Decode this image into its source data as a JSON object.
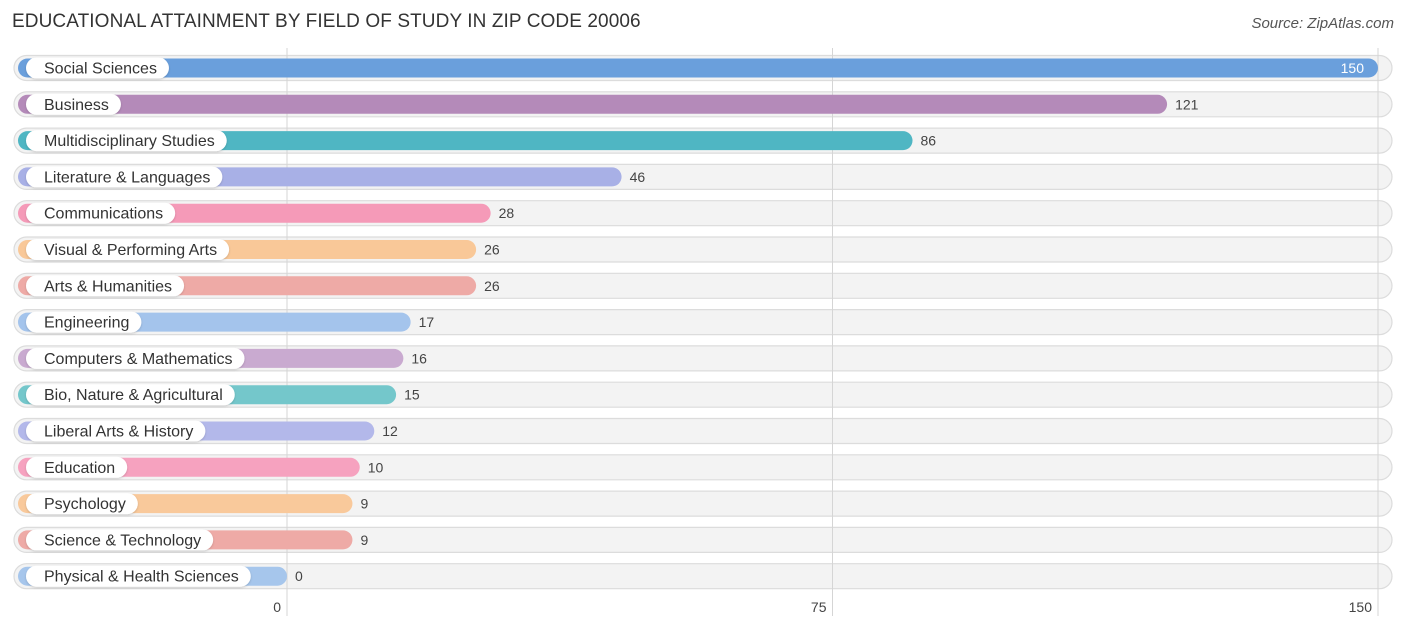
{
  "header": {
    "title": "EDUCATIONAL ATTAINMENT BY FIELD OF STUDY IN ZIP CODE 20006",
    "source": "Source: ZipAtlas.com"
  },
  "chart_data": {
    "type": "bar",
    "orientation": "horizontal",
    "title": "EDUCATIONAL ATTAINMENT BY FIELD OF STUDY IN ZIP CODE 20006",
    "xlabel": "",
    "ylabel": "",
    "xlim": [
      0,
      150
    ],
    "xticks": [
      0,
      75,
      150
    ],
    "xtick_labels": [
      "0",
      "75",
      "150"
    ],
    "grid": true,
    "categories": [
      "Social Sciences",
      "Business",
      "Multidisciplinary Studies",
      "Literature & Languages",
      "Communications",
      "Visual & Performing Arts",
      "Arts & Humanities",
      "Engineering",
      "Computers & Mathematics",
      "Bio, Nature & Agricultural",
      "Liberal Arts & History",
      "Education",
      "Psychology",
      "Science & Technology",
      "Physical & Health Sciences"
    ],
    "values": [
      150,
      121,
      86,
      46,
      28,
      26,
      26,
      17,
      16,
      15,
      12,
      10,
      9,
      9,
      0
    ],
    "colors": [
      "#6a9fdc",
      "#b48ab9",
      "#4fb6c3",
      "#a8b0e6",
      "#f59ab8",
      "#f9c898",
      "#eeaaa6",
      "#a4c4ec",
      "#c9aad0",
      "#74c7cb",
      "#b3b8ea",
      "#f6a2bf",
      "#f9c99b",
      "#eeaaa6",
      "#a6c6ec"
    ]
  }
}
